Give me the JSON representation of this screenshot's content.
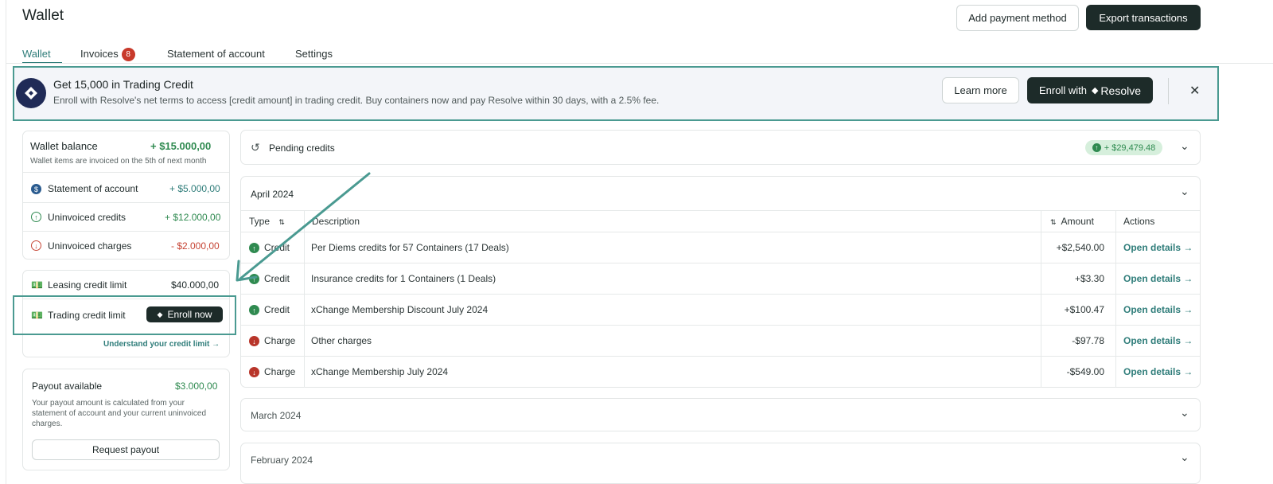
{
  "header": {
    "title": "Wallet",
    "add_payment_label": "Add payment method",
    "export_label": "Export transactions"
  },
  "tabs": [
    {
      "label": "Wallet",
      "active": true
    },
    {
      "label": "Invoices",
      "badge": "8"
    },
    {
      "label": "Statement of account"
    },
    {
      "label": "Settings"
    }
  ],
  "banner": {
    "title": "Get 15,000 in Trading Credit",
    "subtitle": "Enroll with Resolve's net terms to access [credit amount] in trading credit. Buy containers now and pay Resolve within 30 days, with a 2.5% fee.",
    "learn_more": "Learn more",
    "enroll_prefix": "Enroll with",
    "enroll_brand": "Resolve"
  },
  "wallet_balance": {
    "title": "Wallet balance",
    "amount": "+ $15.000,00",
    "note": "Wallet items are invoiced on the 5th of next month",
    "items": [
      {
        "label": "Statement of account",
        "amount": "+ $5.000,00"
      },
      {
        "label": "Uninvoiced credits",
        "amount": "+ $12.000,00"
      },
      {
        "label": "Uninvoiced charges",
        "amount": "- $2.000,00"
      }
    ]
  },
  "credit_limits": {
    "leasing_label": "Leasing credit limit",
    "leasing_amount": "$40.000,00",
    "trading_label": "Trading credit limit",
    "enroll_now": "Enroll now",
    "understand_link": "Understand your credit limit →"
  },
  "payout": {
    "title": "Payout available",
    "amount": "$3.000,00",
    "note": "Your payout amount is calculated from your statement of account and your current uninvoiced charges.",
    "button": "Request payout"
  },
  "pending": {
    "label": "Pending credits",
    "amount": "+ $29,479.48"
  },
  "months": [
    {
      "label": "April 2024",
      "expanded": true
    },
    {
      "label": "March 2024"
    },
    {
      "label": "February 2024"
    }
  ],
  "table": {
    "headers": {
      "type": "Type",
      "description": "Description",
      "amount": "Amount",
      "actions": "Actions"
    },
    "rows": [
      {
        "type": "Credit",
        "kind": "credit",
        "description": "Per Diems credits for 57 Containers (17 Deals)",
        "amount": "+$2,540.00",
        "action": "Open details →"
      },
      {
        "type": "Credit",
        "kind": "credit",
        "description": "Insurance credits for 1 Containers (1 Deals)",
        "amount": "+$3.30",
        "action": "Open details →"
      },
      {
        "type": "Credit",
        "kind": "credit",
        "description": "xChange Membership Discount July 2024",
        "amount": "+$100.47",
        "action": "Open details →"
      },
      {
        "type": "Charge",
        "kind": "charge",
        "description": "Other charges",
        "amount": "-$97.78",
        "action": "Open details →"
      },
      {
        "type": "Charge",
        "kind": "charge",
        "description": "xChange Membership July 2024",
        "amount": "-$549.00",
        "action": "Open details →"
      }
    ]
  },
  "colors": {
    "accent": "#2f7d7a",
    "dark_button": "#1d2b29",
    "credit": "#2f8a50",
    "charge": "#c64535",
    "annotation": "#4a9a91"
  }
}
